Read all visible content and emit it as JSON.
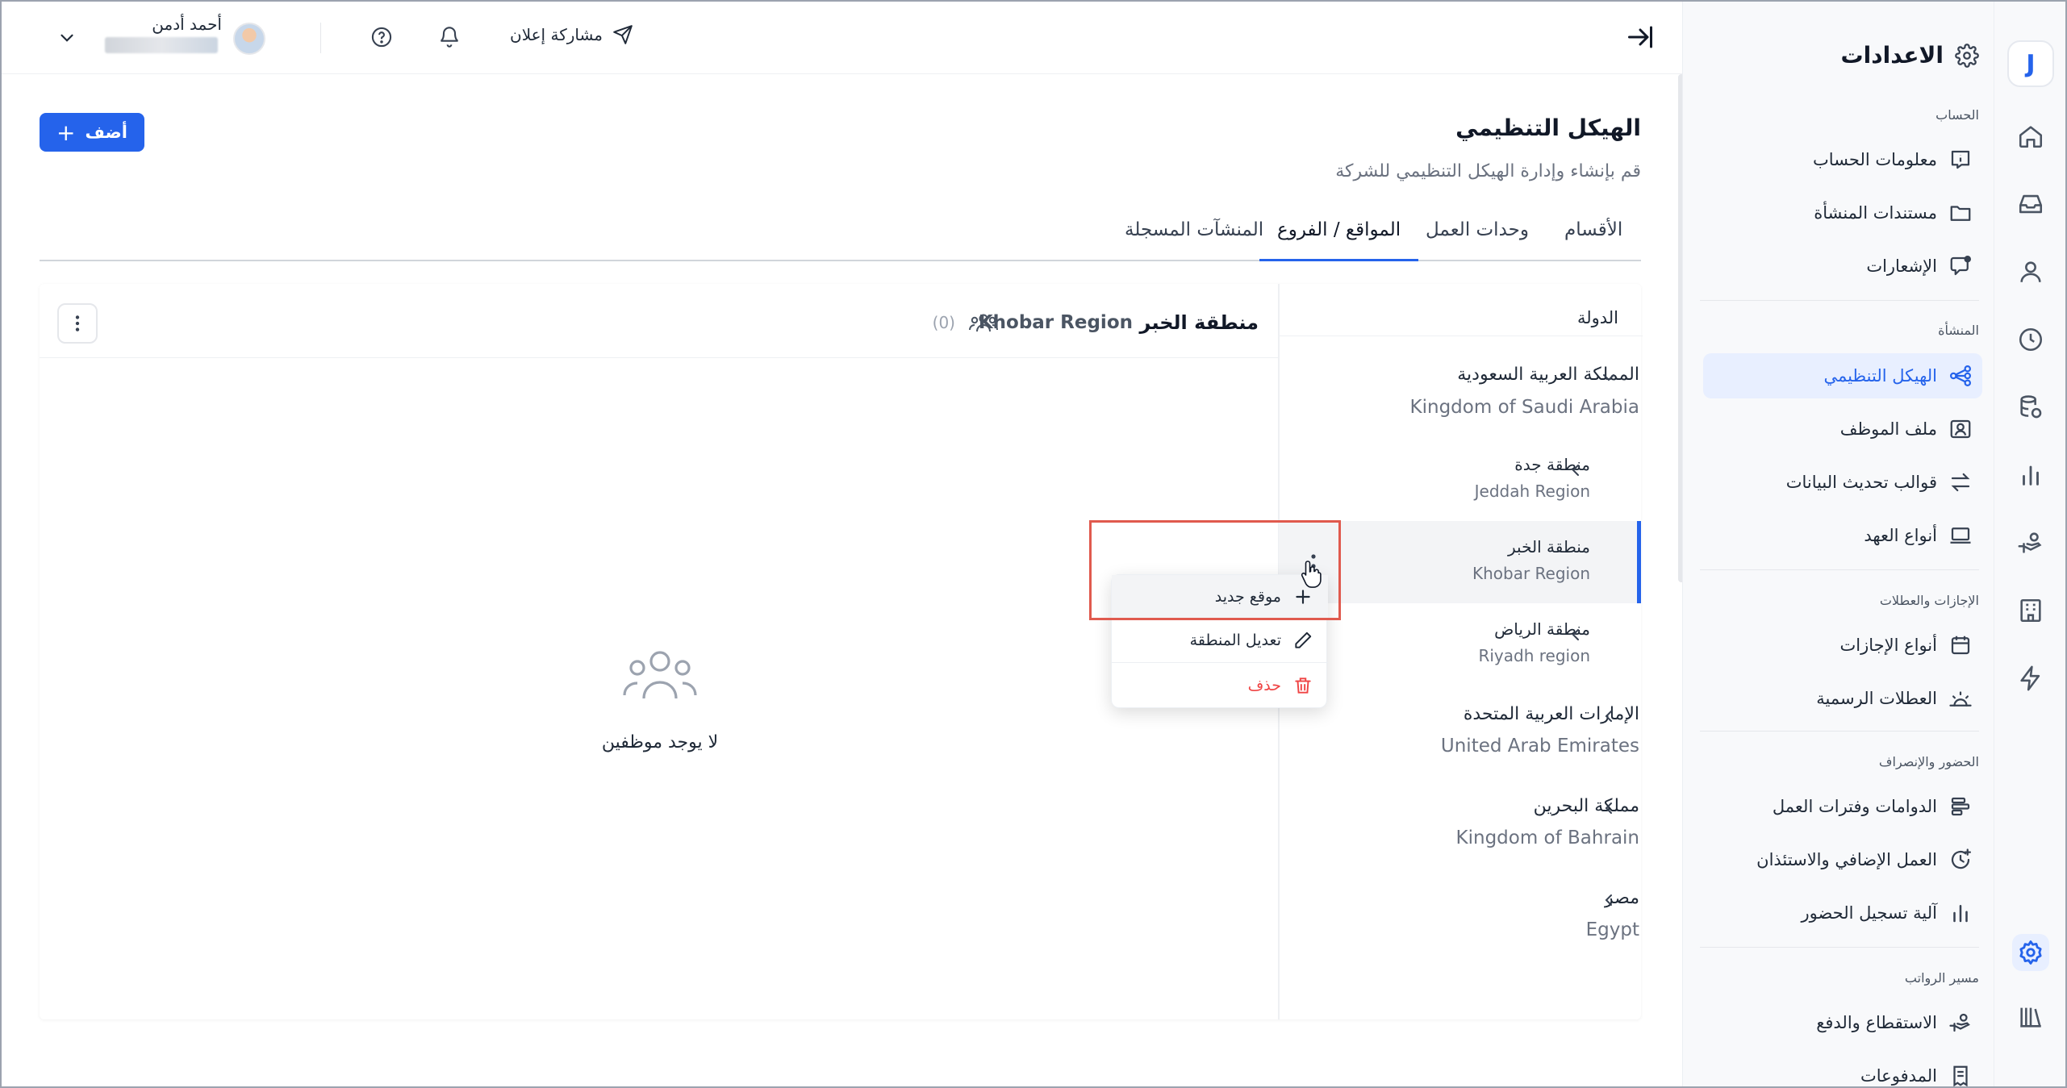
{
  "app": {
    "settings_title": "الاعدادات",
    "logo_letter": "J"
  },
  "topbar": {
    "share_label": "مشاركة إعلان",
    "user_name": "أحمد أدمن"
  },
  "sidebar": {
    "groups": {
      "account": "الحساب",
      "facility": "المنشأة",
      "leaves": "الإجازات والعطلات",
      "attendance": "الحضور والإنصراف",
      "payroll": "مسير الرواتب"
    },
    "items": {
      "account_info": "معلومات الحساب",
      "facility_docs": "مستندات المنشأة",
      "notifications": "الإشعارات",
      "org_structure": "الهيكل التنظيمي",
      "employee_file": "ملف الموظف",
      "data_templates": "قوالب تحديث البيانات",
      "custody_types": "أنواع العهد",
      "leave_types": "أنواع الإجازات",
      "holidays": "العطلات الرسمية",
      "shifts": "الدوامات وفترات العمل",
      "overtime": "العمل الإضافي والاستئذان",
      "attendance_mech": "آلية تسجيل الحضور",
      "deductions": "الاستقطاع والدفع",
      "payments": "المدفوعات"
    }
  },
  "page": {
    "title": "الهيكل التنظيمي",
    "description": "قم بإنشاء وإدارة الهيكل التنظيمي للشركة",
    "add_button": "أضف",
    "tabs": {
      "departments": "الأقسام",
      "work_units": "وحدات العمل",
      "locations": "المواقع / الفروع",
      "facilities": "المنشآت المسجلة"
    }
  },
  "tree": {
    "header": "الدولة",
    "ksa_ar": "المملكة العربية السعودية",
    "ksa_en": "Kingdom of Saudi Arabia",
    "jeddah_ar": "منطقة جدة",
    "jeddah_en": "Jeddah Region",
    "khobar_ar": "منطقة الخبر",
    "khobar_en": "Khobar Region",
    "riyadh_ar": "منطقة الرياض",
    "riyadh_en": "Riyadh region",
    "uae_ar": "الإمارات العربية المتحدة",
    "uae_en": "United Arab Emirates",
    "bahrain_ar": "مملكة البحرين",
    "bahrain_en": "Kingdom of Bahrain",
    "egypt_ar": "مصر",
    "egypt_en": "Egypt"
  },
  "content": {
    "region_ar": "منطقة الخبر",
    "region_en": "Khobar Region",
    "employee_count": "(0)",
    "empty_text": "لا يوجد موظفين"
  },
  "menu": {
    "new_location": "موقع جديد",
    "edit_region": "تعديل المنطقة",
    "delete": "حذف"
  },
  "colors": {
    "primary": "#2563eb",
    "danger": "#ef4444",
    "highlight": "#e05a4e"
  }
}
